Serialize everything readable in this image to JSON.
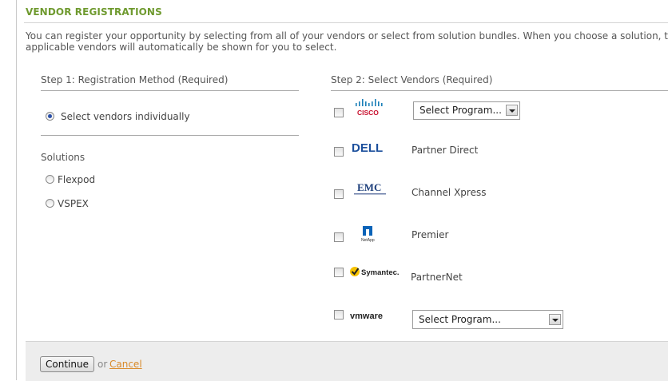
{
  "section": {
    "title": "VENDOR REGISTRATIONS",
    "intro": "You can register your opportunity by selecting from all of your vendors or select from solution bundles. When you choose a solution, the applicable vendors will automatically be shown for you to select."
  },
  "step1": {
    "heading": "Step 1: Registration Method (Required)",
    "individual_label": "Select vendors individually",
    "solutions_heading": "Solutions",
    "solutions": [
      "Flexpod",
      "VSPEX"
    ]
  },
  "step2": {
    "heading": "Step 2: Select Vendors (Required)",
    "vendors": [
      {
        "logo": "cisco-logo",
        "logo_text": "CISCO",
        "program": "Select Program...",
        "type": "select"
      },
      {
        "logo": "dell-logo",
        "logo_text": "DELL",
        "program": "Partner Direct",
        "type": "text"
      },
      {
        "logo": "emc-logo",
        "logo_text": "EMC",
        "program": "Channel Xpress",
        "type": "text"
      },
      {
        "logo": "netapp-logo",
        "logo_text": "NetApp",
        "program": "Premier",
        "type": "text"
      },
      {
        "logo": "symantec-logo",
        "logo_text": "Symantec.",
        "program": "PartnerNet",
        "type": "text"
      },
      {
        "logo": "vmware-logo",
        "logo_text": "vmware",
        "program": "Select Program...",
        "type": "select"
      }
    ]
  },
  "footer": {
    "continue_label": "Continue",
    "or_text": "or",
    "cancel_label": "Cancel"
  },
  "colors": {
    "accent_green": "#6f9a2f",
    "cancel_orange": "#d98a2a",
    "footer_bg": "#ededed"
  }
}
